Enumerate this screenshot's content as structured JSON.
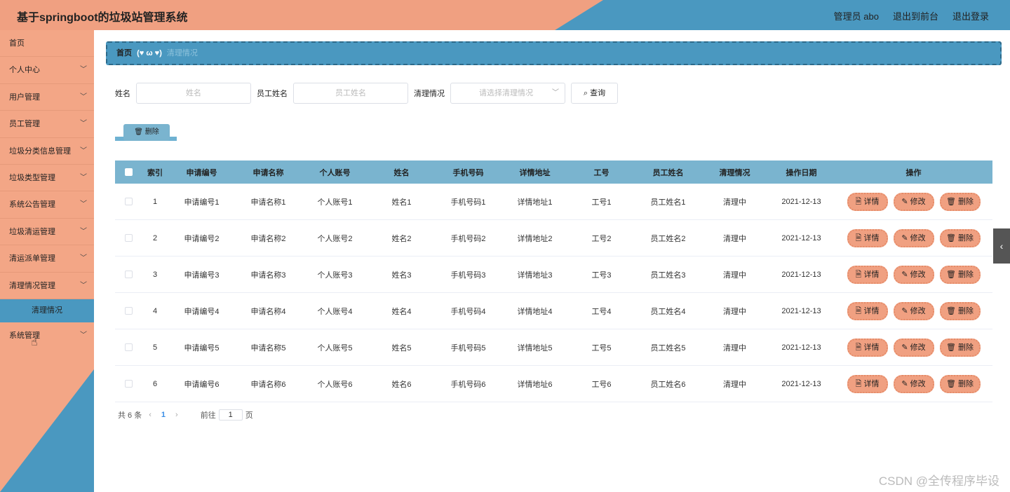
{
  "header": {
    "title": "基于springboot的垃圾站管理系统",
    "admin": "管理员 abo",
    "to_front": "退出到前台",
    "logout": "退出登录"
  },
  "sidebar": {
    "items": [
      {
        "label": "首页",
        "chevron": false
      },
      {
        "label": "个人中心",
        "chevron": true
      },
      {
        "label": "用户管理",
        "chevron": true
      },
      {
        "label": "员工管理",
        "chevron": true
      },
      {
        "label": "垃圾分类信息管理",
        "chevron": true
      },
      {
        "label": "垃圾类型管理",
        "chevron": true
      },
      {
        "label": "系统公告管理",
        "chevron": true
      },
      {
        "label": "垃圾清运管理",
        "chevron": true
      },
      {
        "label": "清运派单管理",
        "chevron": true
      },
      {
        "label": "清理情况管理",
        "chevron": true
      }
    ],
    "submenu_active": "清理情况",
    "last_item": "系统管理"
  },
  "breadcrumb": {
    "home": "首页",
    "emoticon": "(♥ ω ♥)",
    "current": "清理情况"
  },
  "search": {
    "name_label": "姓名",
    "name_placeholder": "姓名",
    "staff_label": "员工姓名",
    "staff_placeholder": "员工姓名",
    "status_label": "清理情况",
    "status_placeholder": "请选择清理情况",
    "query_label": "查询"
  },
  "toolbar": {
    "delete_label": "删除"
  },
  "table": {
    "headers": [
      "索引",
      "申请编号",
      "申请名称",
      "个人账号",
      "姓名",
      "手机号码",
      "详情地址",
      "工号",
      "员工姓名",
      "清理情况",
      "操作日期",
      "操作"
    ],
    "rows": [
      [
        "1",
        "申请编号1",
        "申请名称1",
        "个人账号1",
        "姓名1",
        "手机号码1",
        "详情地址1",
        "工号1",
        "员工姓名1",
        "清理中",
        "2021-12-13"
      ],
      [
        "2",
        "申请编号2",
        "申请名称2",
        "个人账号2",
        "姓名2",
        "手机号码2",
        "详情地址2",
        "工号2",
        "员工姓名2",
        "清理中",
        "2021-12-13"
      ],
      [
        "3",
        "申请编号3",
        "申请名称3",
        "个人账号3",
        "姓名3",
        "手机号码3",
        "详情地址3",
        "工号3",
        "员工姓名3",
        "清理中",
        "2021-12-13"
      ],
      [
        "4",
        "申请编号4",
        "申请名称4",
        "个人账号4",
        "姓名4",
        "手机号码4",
        "详情地址4",
        "工号4",
        "员工姓名4",
        "清理中",
        "2021-12-13"
      ],
      [
        "5",
        "申请编号5",
        "申请名称5",
        "个人账号5",
        "姓名5",
        "手机号码5",
        "详情地址5",
        "工号5",
        "员工姓名5",
        "清理中",
        "2021-12-13"
      ],
      [
        "6",
        "申请编号6",
        "申请名称6",
        "个人账号6",
        "姓名6",
        "手机号码6",
        "详情地址6",
        "工号6",
        "员工姓名6",
        "清理中",
        "2021-12-13"
      ]
    ],
    "actions": {
      "detail": "详情",
      "edit": "修改",
      "delete": "删除"
    }
  },
  "pagination": {
    "total": "共 6 条",
    "current_page": "1",
    "goto_label": "前往",
    "goto_value": "1",
    "page_suffix": "页"
  },
  "watermark": "CSDN @全传程序毕设",
  "colors": {
    "accent_orange": "#f0a081",
    "accent_blue": "#4a98c0"
  }
}
